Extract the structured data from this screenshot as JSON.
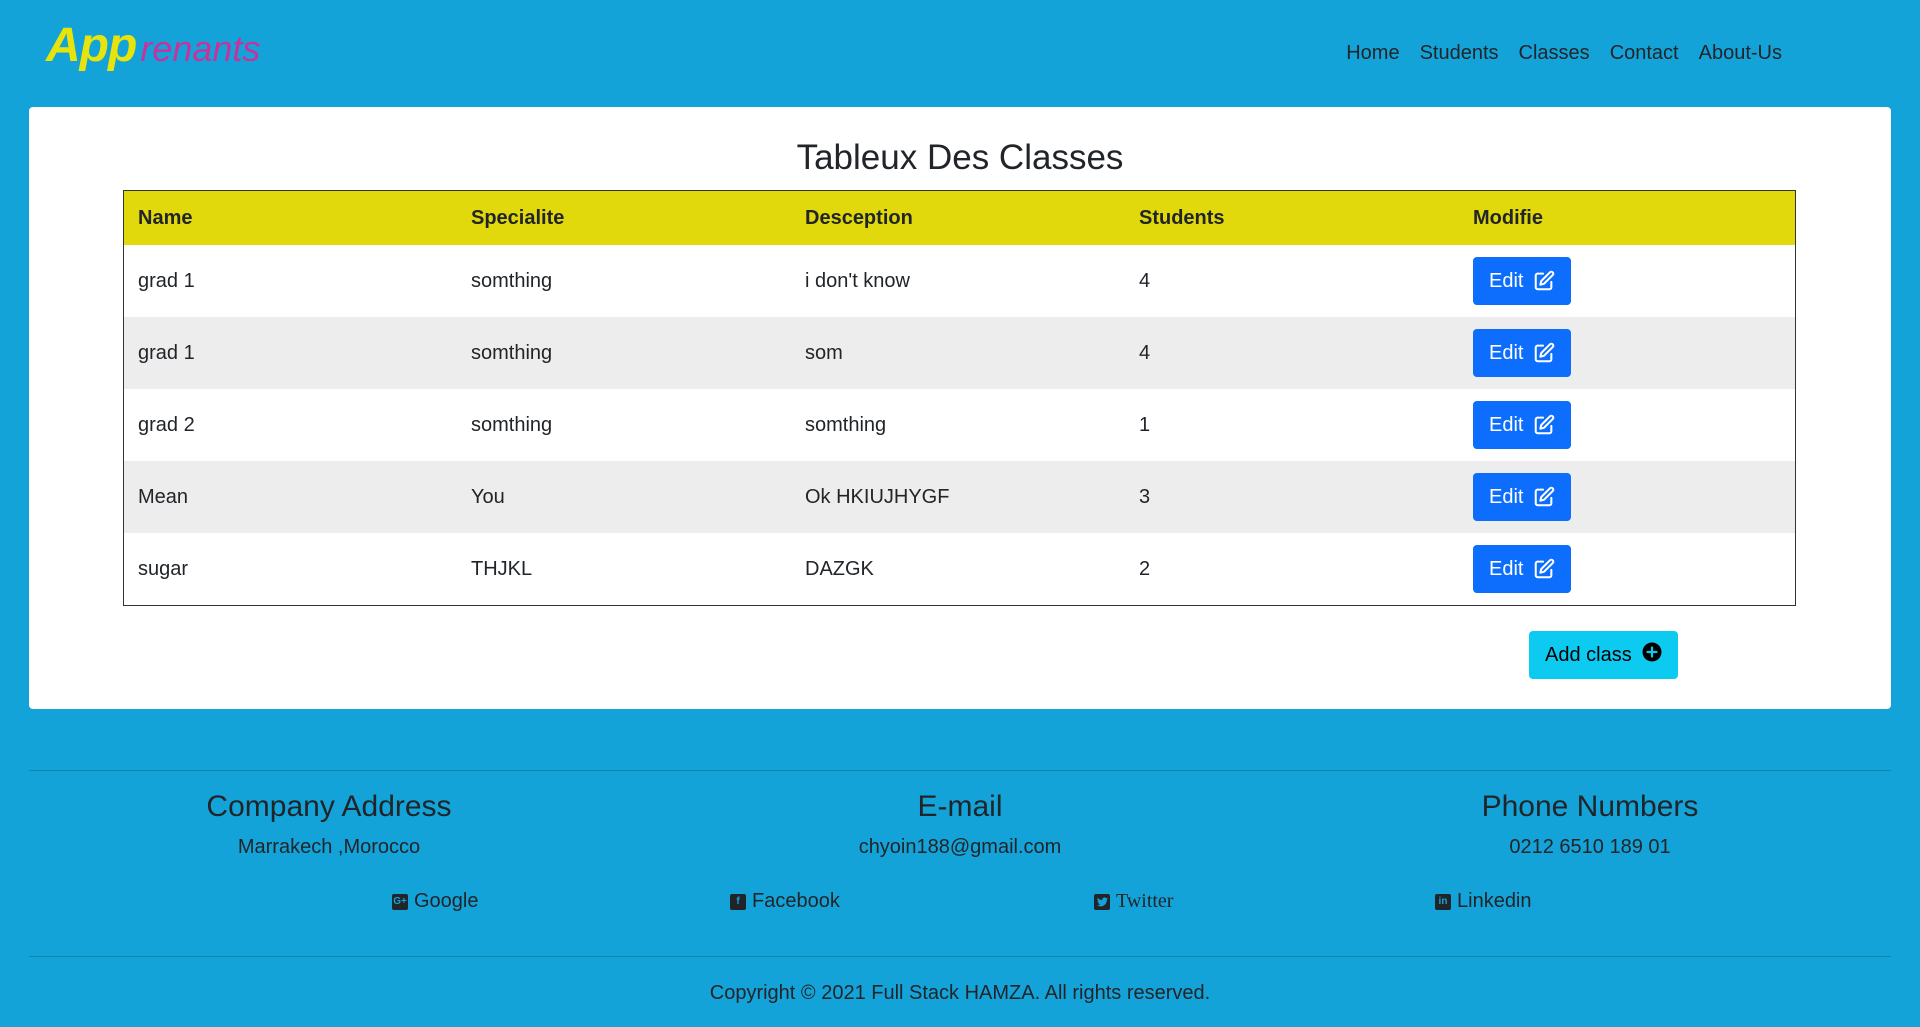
{
  "brand": {
    "logo_main": "App",
    "logo_rest": "renants"
  },
  "nav": {
    "items": [
      {
        "label": "Home"
      },
      {
        "label": "Students"
      },
      {
        "label": "Classes"
      },
      {
        "label": "Contact"
      },
      {
        "label": "About-Us"
      }
    ]
  },
  "main": {
    "title": "Tableux Des Classes",
    "columns": [
      "Name",
      "Specialite",
      "Desception",
      "Students",
      "Modifie"
    ],
    "rows": [
      {
        "name": "grad 1",
        "specialite": "somthing",
        "description": "i don't know",
        "students": "4"
      },
      {
        "name": "grad 1",
        "specialite": "somthing",
        "description": "som",
        "students": "4"
      },
      {
        "name": "grad 2",
        "specialite": "somthing",
        "description": "somthing",
        "students": "1"
      },
      {
        "name": "Mean",
        "specialite": "You",
        "description": "Ok HKIUJHYGF",
        "students": "3"
      },
      {
        "name": "sugar",
        "specialite": "THJKL",
        "description": "DAZGK",
        "students": "2"
      }
    ],
    "edit_label": "Edit",
    "add_label": "Add class"
  },
  "footer": {
    "address": {
      "heading": "Company Address",
      "value": "Marrakech ,Morocco"
    },
    "email": {
      "heading": "E-mail",
      "value": "chyoin188@gmail.com"
    },
    "phone": {
      "heading": "Phone Numbers",
      "value": "0212 6510 189 01"
    },
    "social": [
      {
        "label": "Google",
        "icon": "google-plus-square-icon"
      },
      {
        "label": "Facebook",
        "icon": "facebook-square-icon"
      },
      {
        "label": "Twitter",
        "icon": "twitter-square-icon"
      },
      {
        "label": "Linkedin",
        "icon": "linkedin-square-icon"
      }
    ],
    "copyright": "Copyright © 2021 Full Stack HAMZA. All rights reserved."
  },
  "colors": {
    "background": "#14a3d9",
    "table_header": "#e1d90c",
    "edit_button": "#0d6efd",
    "add_button": "#0dcaf0",
    "logo_app": "#e7e40c",
    "logo_rest": "#c7329c"
  }
}
